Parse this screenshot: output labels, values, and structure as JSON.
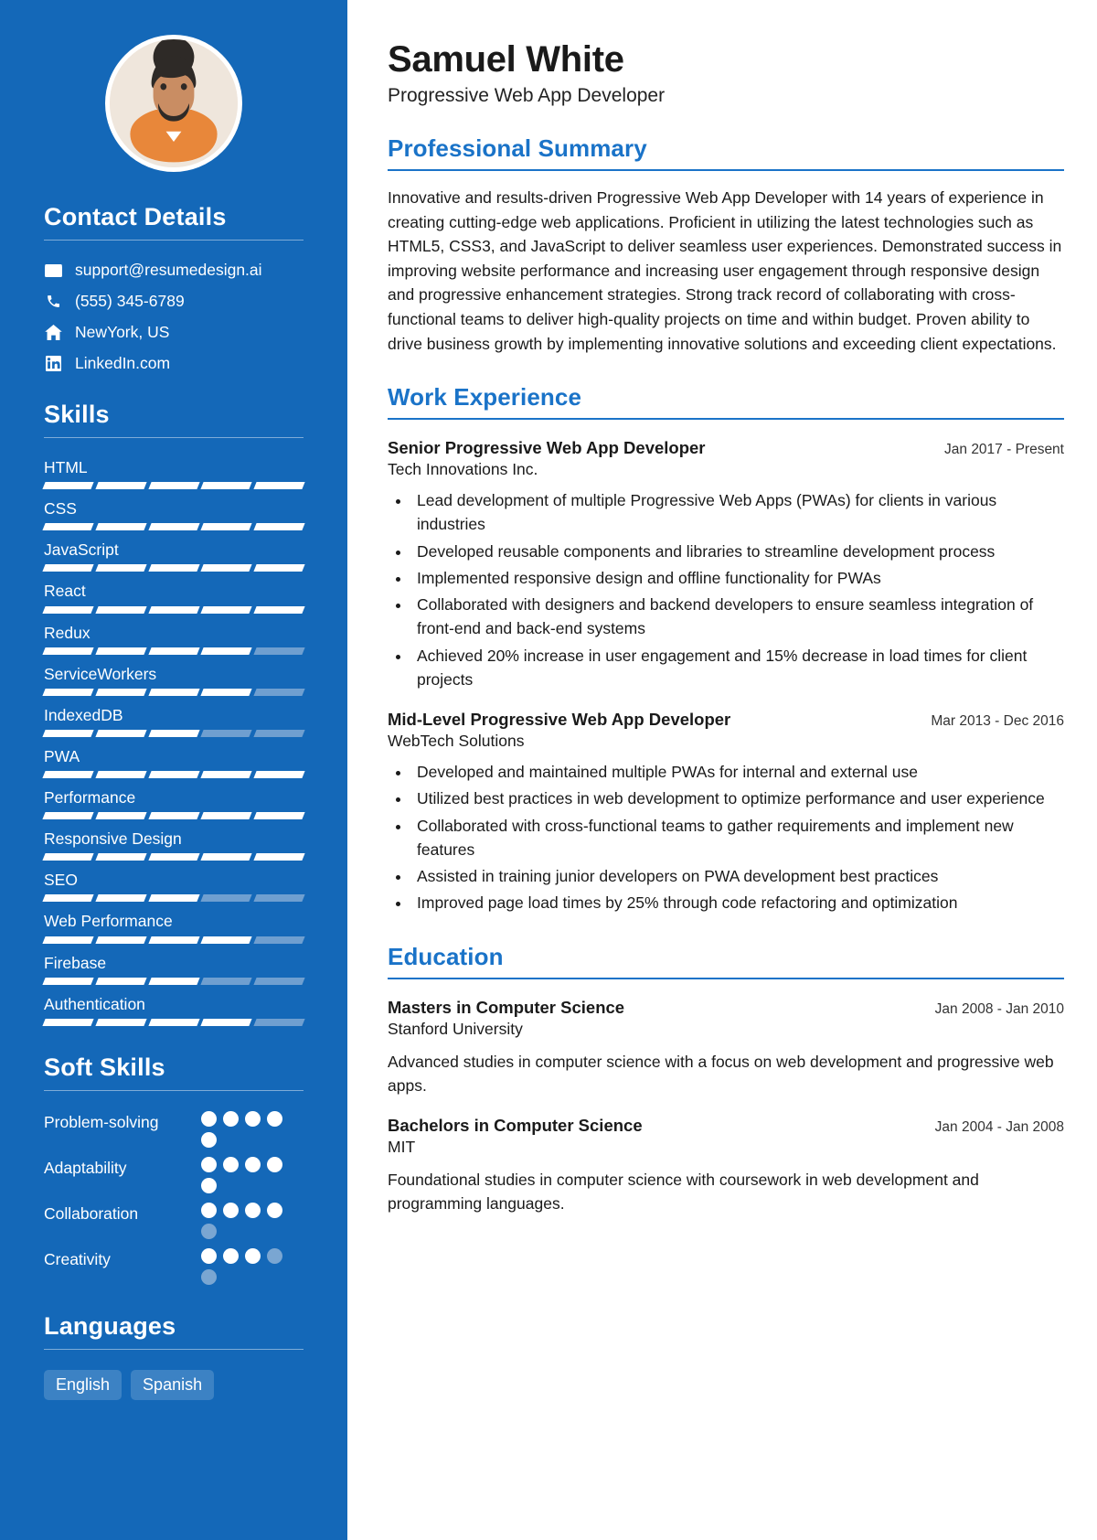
{
  "theme": {
    "sidebar_bg": "#1468b8",
    "accent": "#1a73c8",
    "bar_on": "#ffffff",
    "bar_off": "#6f9fd0"
  },
  "header": {
    "name": "Samuel White",
    "role": "Progressive Web App Developer"
  },
  "sidebar": {
    "contact": {
      "heading": "Contact Details",
      "items": [
        {
          "icon": "envelope-icon",
          "text": "support@resumedesign.ai"
        },
        {
          "icon": "phone-icon",
          "text": "(555) 345-6789"
        },
        {
          "icon": "home-icon",
          "text": "NewYork, US"
        },
        {
          "icon": "linkedin-icon",
          "text": "LinkedIn.com"
        }
      ]
    },
    "skills": {
      "heading": "Skills",
      "max": 5,
      "items": [
        {
          "name": "HTML",
          "level": 5
        },
        {
          "name": "CSS",
          "level": 5
        },
        {
          "name": "JavaScript",
          "level": 5
        },
        {
          "name": "React",
          "level": 5
        },
        {
          "name": "Redux",
          "level": 4
        },
        {
          "name": "ServiceWorkers",
          "level": 4
        },
        {
          "name": "IndexedDB",
          "level": 3
        },
        {
          "name": "PWA",
          "level": 5
        },
        {
          "name": "Performance",
          "level": 5
        },
        {
          "name": "Responsive Design",
          "level": 5
        },
        {
          "name": "SEO",
          "level": 3
        },
        {
          "name": "Web Performance",
          "level": 4
        },
        {
          "name": "Firebase",
          "level": 3
        },
        {
          "name": "Authentication",
          "level": 4
        }
      ]
    },
    "soft_skills": {
      "heading": "Soft Skills",
      "max": 5,
      "items": [
        {
          "name": "Problem-solving",
          "level": 5
        },
        {
          "name": "Adaptability",
          "level": 5
        },
        {
          "name": "Collaboration",
          "level": 4
        },
        {
          "name": "Creativity",
          "level": 3
        }
      ]
    },
    "languages": {
      "heading": "Languages",
      "items": [
        "English",
        "Spanish"
      ]
    }
  },
  "main": {
    "summary": {
      "heading": "Professional Summary",
      "text": "Innovative and results-driven Progressive Web App Developer with 14 years of experience in creating cutting-edge web applications. Proficient in utilizing the latest technologies such as HTML5, CSS3, and JavaScript to deliver seamless user experiences. Demonstrated success in improving website performance and increasing user engagement through responsive design and progressive enhancement strategies. Strong track record of collaborating with cross-functional teams to deliver high-quality projects on time and within budget. Proven ability to drive business growth by implementing innovative solutions and exceeding client expectations."
    },
    "work": {
      "heading": "Work Experience",
      "entries": [
        {
          "title": "Senior Progressive Web App Developer",
          "date": "Jan 2017 - Present",
          "org": "Tech Innovations Inc.",
          "bullets": [
            "Lead development of multiple Progressive Web Apps (PWAs) for clients in various industries",
            "Developed reusable components and libraries to streamline development process",
            "Implemented responsive design and offline functionality for PWAs",
            "Collaborated with designers and backend developers to ensure seamless integration of front-end and back-end systems",
            "Achieved 20% increase in user engagement and 15% decrease in load times for client projects"
          ]
        },
        {
          "title": "Mid-Level Progressive Web App Developer",
          "date": "Mar 2013 - Dec 2016",
          "org": "WebTech Solutions",
          "bullets": [
            "Developed and maintained multiple PWAs for internal and external use",
            "Utilized best practices in web development to optimize performance and user experience",
            "Collaborated with cross-functional teams to gather requirements and implement new features",
            "Assisted in training junior developers on PWA development best practices",
            "Improved page load times by 25% through code refactoring and optimization"
          ]
        }
      ]
    },
    "education": {
      "heading": "Education",
      "entries": [
        {
          "title": "Masters in Computer Science",
          "date": "Jan 2008 - Jan 2010",
          "org": "Stanford University",
          "desc": "Advanced studies in computer science with a focus on web development and progressive web apps."
        },
        {
          "title": "Bachelors in Computer Science",
          "date": "Jan 2004 - Jan 2008",
          "org": "MIT",
          "desc": "Foundational studies in computer science with coursework in web development and programming languages."
        }
      ]
    }
  }
}
